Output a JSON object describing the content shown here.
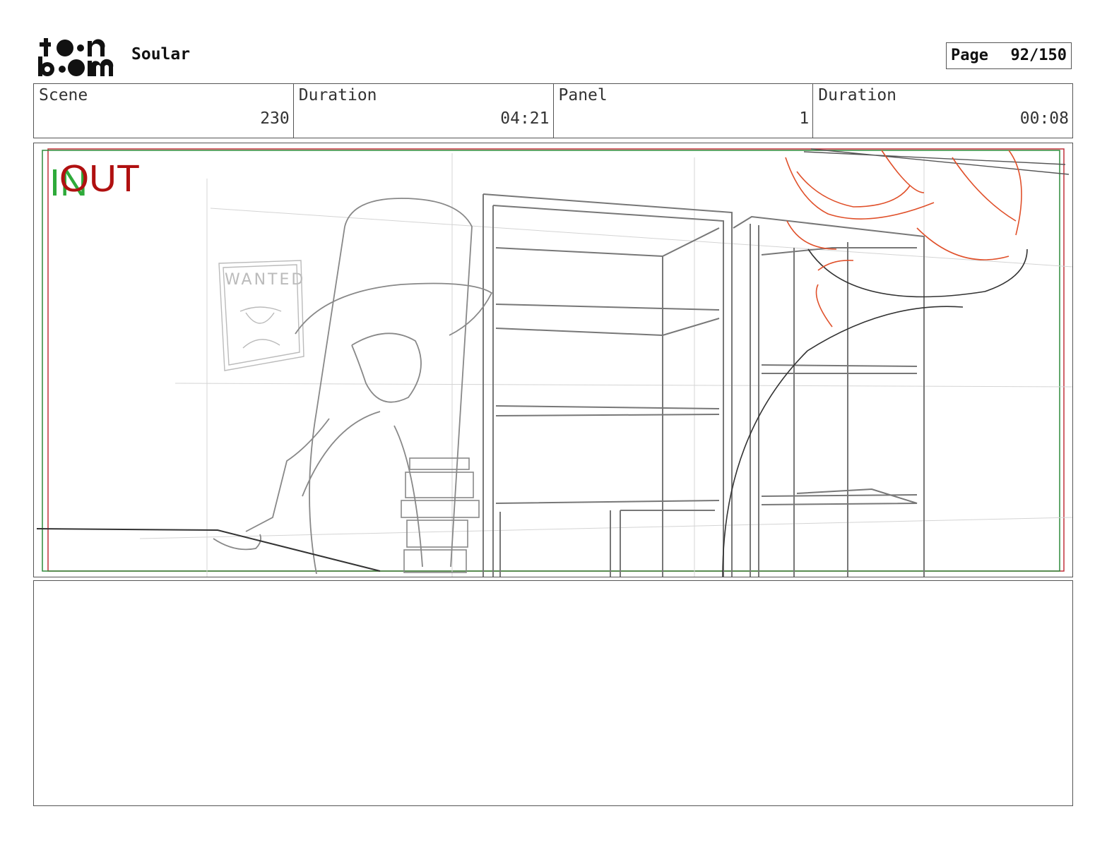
{
  "header": {
    "logo_text_top": "toon",
    "logo_text_bottom": "boom",
    "project_title": "Soular",
    "page_label": "Page",
    "page_value": "92/150"
  },
  "info": [
    {
      "label": "Scene",
      "value": "230"
    },
    {
      "label": "Duration",
      "value": "04:21"
    },
    {
      "label": "Panel",
      "value": "1"
    },
    {
      "label": "Duration",
      "value": "00:08"
    }
  ],
  "panel": {
    "in_marker": "IN",
    "out_marker": "OUT",
    "poster_text": "WANTED",
    "colors": {
      "in": "#2eaa3a",
      "out": "#b01010",
      "sketch": "#888888",
      "red_sketch": "#e0502a"
    }
  },
  "notes": {
    "text": ""
  }
}
